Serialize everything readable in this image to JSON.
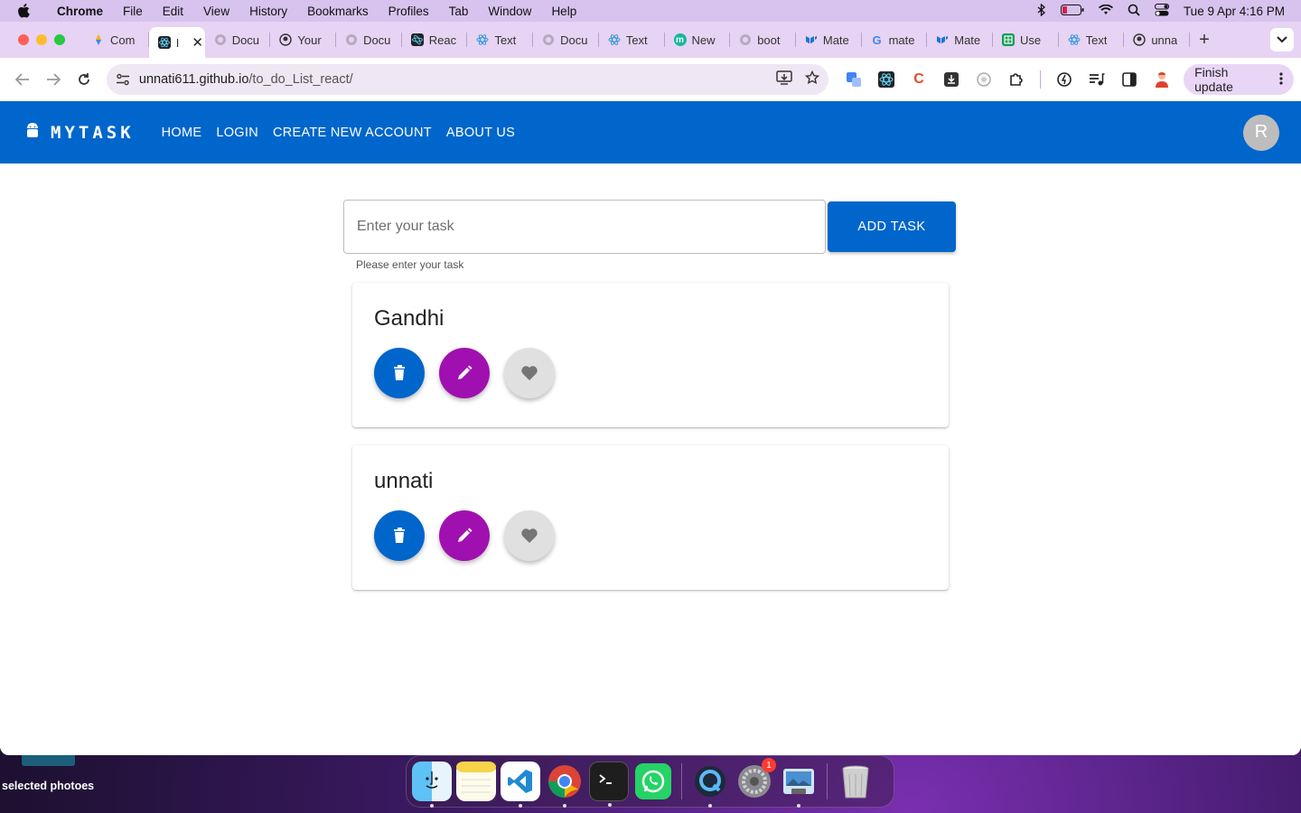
{
  "menubar": {
    "app": "Chrome",
    "items": [
      "File",
      "Edit",
      "View",
      "History",
      "Bookmarks",
      "Profiles",
      "Tab",
      "Window",
      "Help"
    ],
    "clock": "Tue 9 Apr  4:16 PM"
  },
  "browser": {
    "tabs": [
      {
        "label": "Com",
        "icon": "google-photos-icon"
      },
      {
        "label": "I",
        "icon": "react-icon"
      },
      {
        "label": "Docu",
        "icon": "globe-icon"
      },
      {
        "label": "Your",
        "icon": "github-icon"
      },
      {
        "label": "Docu",
        "icon": "globe-icon"
      },
      {
        "label": "Reac",
        "icon": "react-icon"
      },
      {
        "label": "Text",
        "icon": "react-icon"
      },
      {
        "label": "Docu",
        "icon": "globe-icon"
      },
      {
        "label": "Text",
        "icon": "react-icon"
      },
      {
        "label": "New",
        "icon": "m-icon"
      },
      {
        "label": "boot",
        "icon": "globe-icon"
      },
      {
        "label": "Mate",
        "icon": "mui-icon"
      },
      {
        "label": "mate",
        "icon": "google-icon"
      },
      {
        "label": "Mate",
        "icon": "mui-icon"
      },
      {
        "label": "Use",
        "icon": "sheet-icon"
      },
      {
        "label": "Text",
        "icon": "react-icon"
      },
      {
        "label": "unna",
        "icon": "github-icon"
      }
    ],
    "url_host": "unnati611.github.io",
    "url_path": "/to_do_List_react/",
    "finish_update": "Finish update"
  },
  "app": {
    "brand": "MYTASK",
    "nav": [
      "HOME",
      "LOGIN",
      "CREATE NEW ACCOUNT",
      "ABOUT US"
    ],
    "avatar_initial": "R",
    "input_placeholder": "Enter your task",
    "helper_text": "Please enter your task",
    "add_button": "ADD TASK",
    "tasks": [
      {
        "title": "Gandhi"
      },
      {
        "title": "unnati"
      }
    ],
    "colors": {
      "primary": "#0066cc",
      "edit": "#a010b0",
      "favorite": "#e0e0e0"
    }
  },
  "desktop": {
    "label": "selected photoes",
    "dock_badge": "1"
  }
}
